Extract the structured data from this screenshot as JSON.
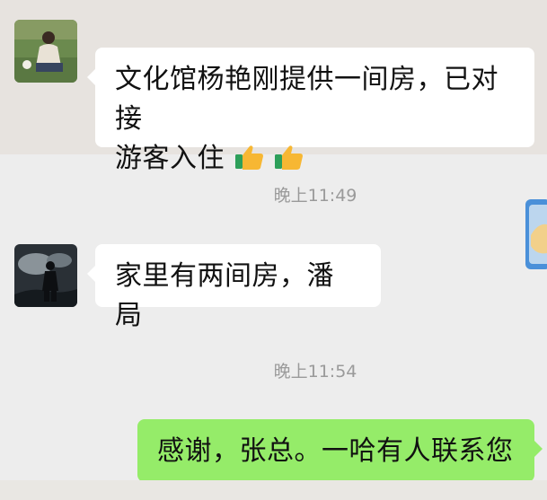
{
  "messages": [
    {
      "text_line1": "文化馆杨艳刚提供一间房，已对接",
      "text_line2": "游客入住"
    },
    {
      "timestamp": "晚上11:49",
      "text": "家里有两间房，潘局"
    },
    {
      "timestamp": "晚上11:54",
      "text": "感谢，张总。一哈有人联系您"
    }
  ],
  "colors": {
    "sent_bubble": "#95ec69",
    "received_bubble": "#ffffff",
    "chat_background": "#ededed",
    "timestamp_text": "#9a9a9a"
  },
  "icons": {
    "emoji_1": "thumbs-up-icon",
    "emoji_2": "thumbs-up-icon"
  }
}
